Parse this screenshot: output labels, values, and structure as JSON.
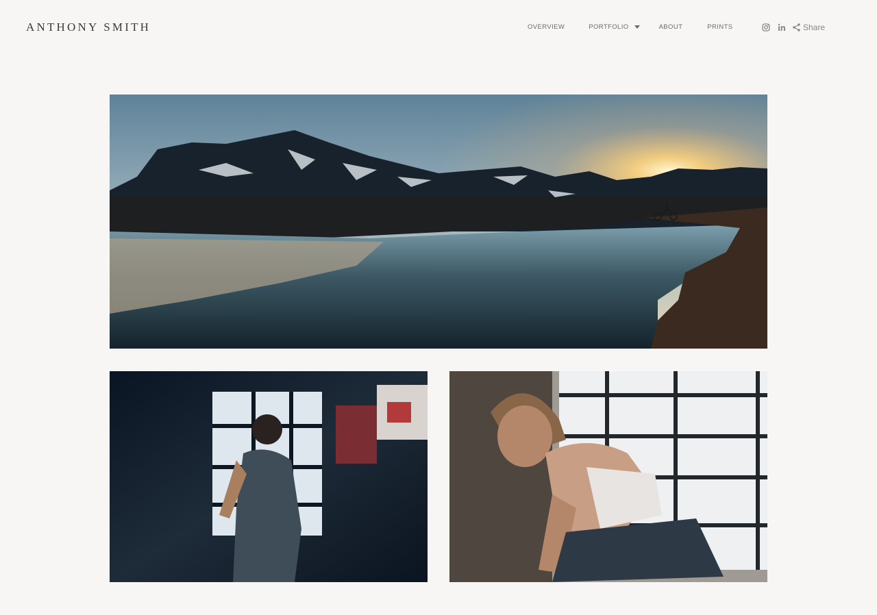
{
  "site": {
    "title": "ANTHONY SMITH"
  },
  "nav": {
    "overview": "OVERVIEW",
    "portfolio": "PORTFOLIO",
    "about": "ABOUT",
    "prints": "PRINTS"
  },
  "social": {
    "instagram_icon": "instagram-icon",
    "linkedin_icon": "linkedin-icon",
    "share_icon": "share-icon",
    "share_label": "Share"
  },
  "gallery": {
    "photos": [
      {
        "subject": "mountain lake at sunset"
      },
      {
        "subject": "woman in gym by window"
      },
      {
        "subject": "woman resting in gym"
      }
    ]
  },
  "colors": {
    "background": "#f7f6f4",
    "title": "#3c3a38",
    "nav_text": "#6e6a66",
    "icon": "#8a8682"
  }
}
